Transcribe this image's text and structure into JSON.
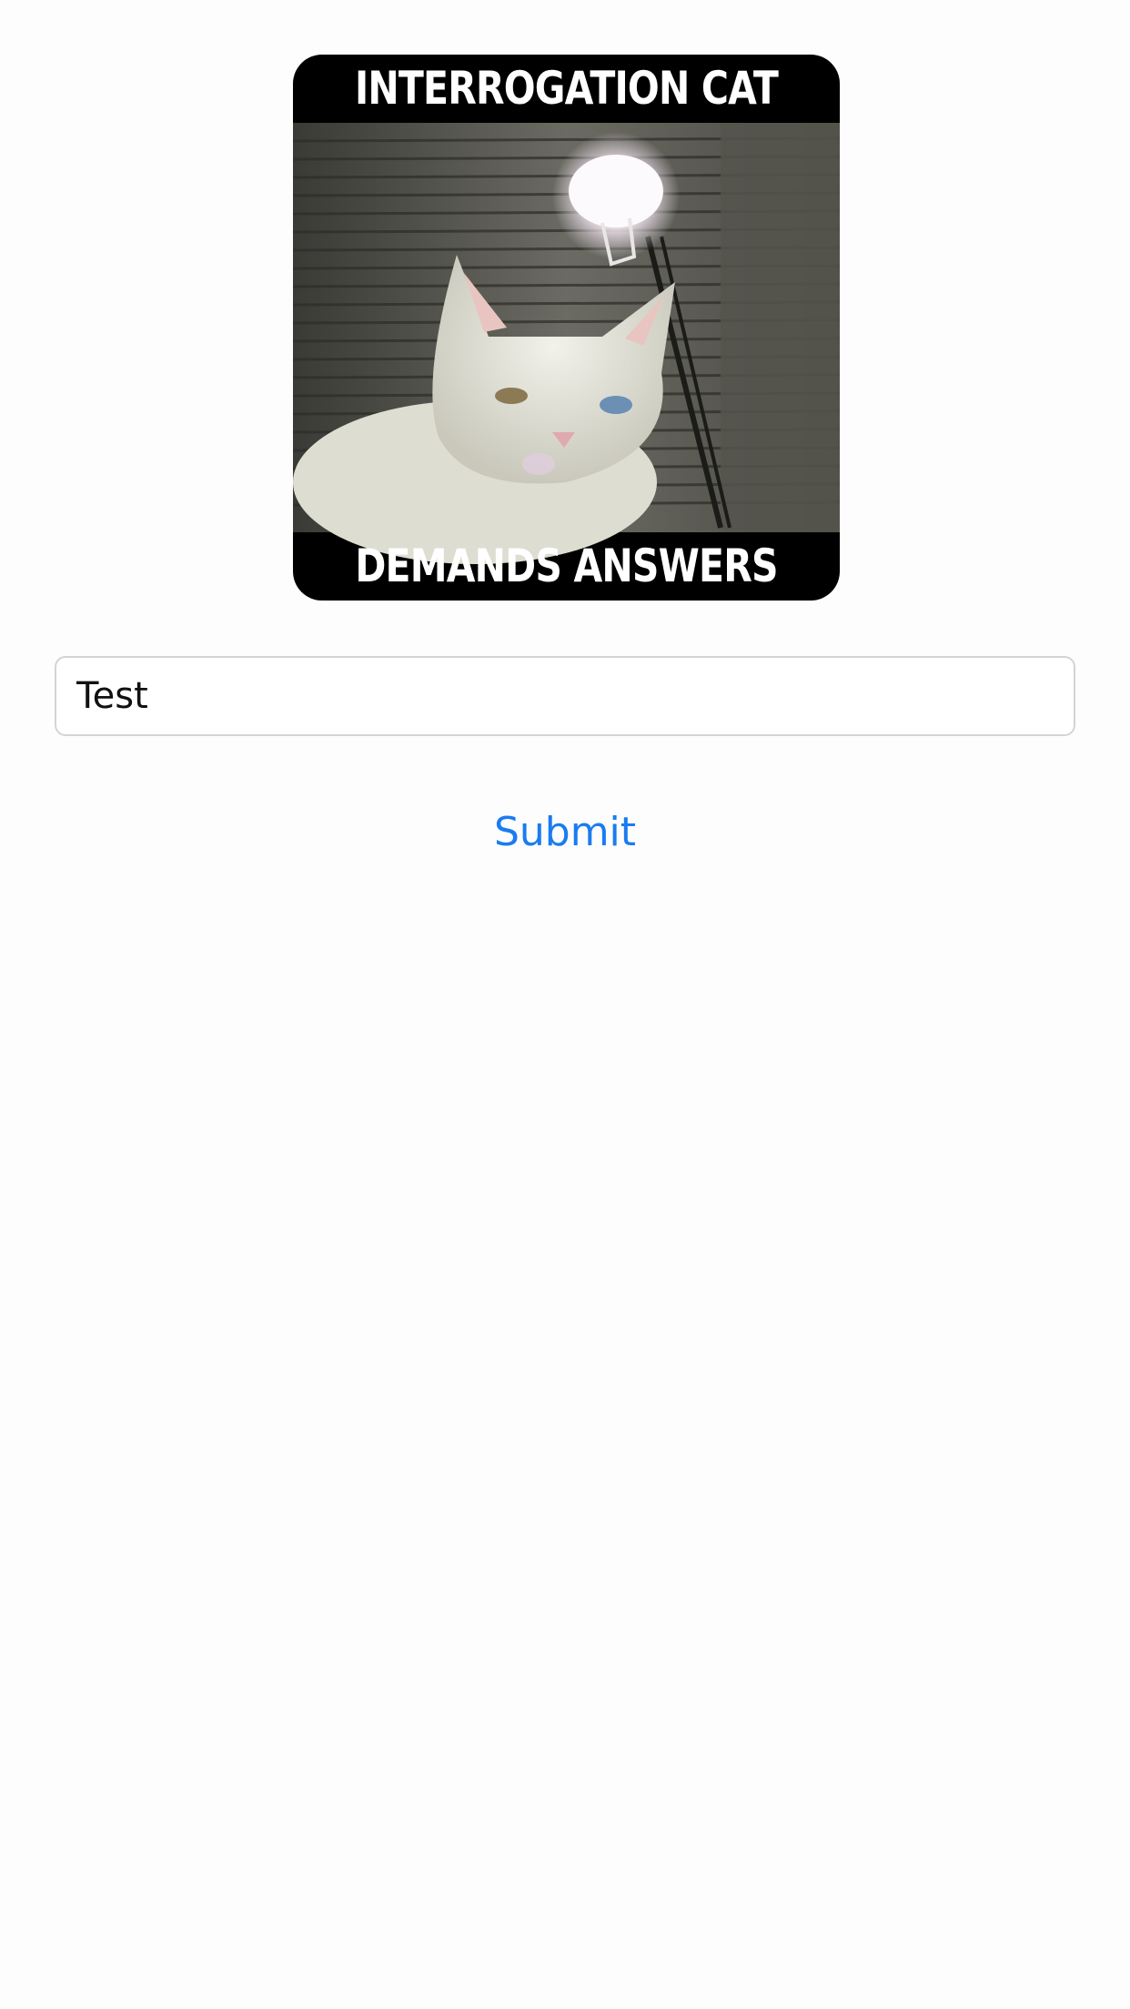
{
  "meme": {
    "top_caption": "INTERROGATION CAT",
    "bottom_caption": "DEMANDS ANSWERS"
  },
  "form": {
    "text_value": "Test",
    "submit_label": "Submit"
  },
  "colors": {
    "background": "#fdfdfd",
    "accent": "#1a7cf0",
    "field_border": "#d4d4d4"
  }
}
